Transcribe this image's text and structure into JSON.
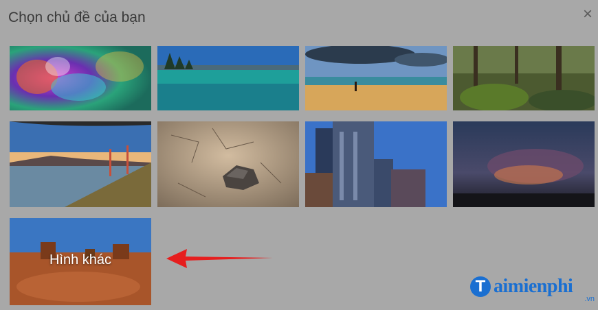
{
  "dialog": {
    "title": "Chọn chủ đề của bạn",
    "close_icon": "close-icon"
  },
  "themes": [
    {
      "name": "abstract-colorful"
    },
    {
      "name": "lake-tahoe"
    },
    {
      "name": "beach-person"
    },
    {
      "name": "mossy-forest"
    },
    {
      "name": "golden-gate"
    },
    {
      "name": "cracked-desert-rock"
    },
    {
      "name": "city-skyscrapers"
    },
    {
      "name": "storm-clouds"
    }
  ],
  "more": {
    "label": "Hình khác"
  },
  "watermark": {
    "logo": "T",
    "name": "aimienphi",
    "tld": ".vn"
  }
}
